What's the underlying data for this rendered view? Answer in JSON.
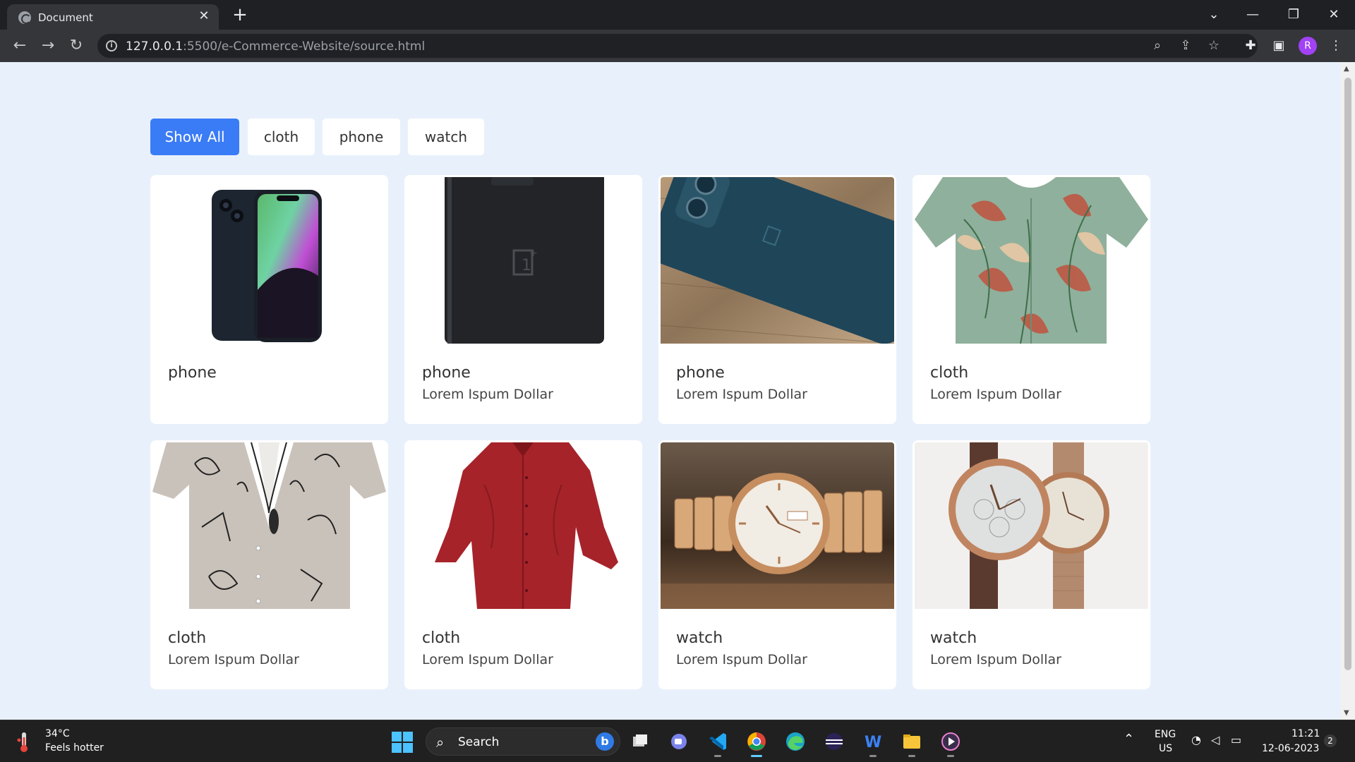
{
  "browser": {
    "tab_title": "Document",
    "tab_close": "✕",
    "new_tab": "+",
    "url_host": "127.0.0.1",
    "url_rest": ":5500/e-Commerce-Website/source.html",
    "window_controls": [
      "⌄",
      "—",
      "❐",
      "✕"
    ],
    "profile_initial": "R"
  },
  "filters": [
    {
      "label": "Show All",
      "active": true
    },
    {
      "label": "cloth",
      "active": false
    },
    {
      "label": "phone",
      "active": false
    },
    {
      "label": "watch",
      "active": false
    }
  ],
  "products": [
    {
      "title": "phone",
      "description": "",
      "image": "phone-black-iphone"
    },
    {
      "title": "phone",
      "description": "Lorem Ispum Dollar",
      "image": "phone-oneplus-back"
    },
    {
      "title": "phone",
      "description": "Lorem Ispum Dollar",
      "image": "phone-blue-on-wood"
    },
    {
      "title": "cloth",
      "description": "Lorem Ispum Dollar",
      "image": "floral-shirt"
    },
    {
      "title": "cloth",
      "description": "Lorem Ispum Dollar",
      "image": "printed-shirt"
    },
    {
      "title": "cloth",
      "description": "Lorem Ispum Dollar",
      "image": "red-shirt"
    },
    {
      "title": "watch",
      "description": "Lorem Ispum Dollar",
      "image": "gold-watch"
    },
    {
      "title": "watch",
      "description": "Lorem Ispum Dollar",
      "image": "pair-watches"
    }
  ],
  "taskbar": {
    "weather_temp": "34°C",
    "weather_desc": "Feels hotter",
    "search_label": "Search",
    "lang_top": "ENG",
    "lang_bottom": "US",
    "time": "11:21",
    "date": "12-06-2023",
    "notification_count": "2"
  },
  "colors": {
    "page_bg": "#e8f1fb",
    "accent": "#3a7bf6",
    "card_bg": "#ffffff"
  }
}
